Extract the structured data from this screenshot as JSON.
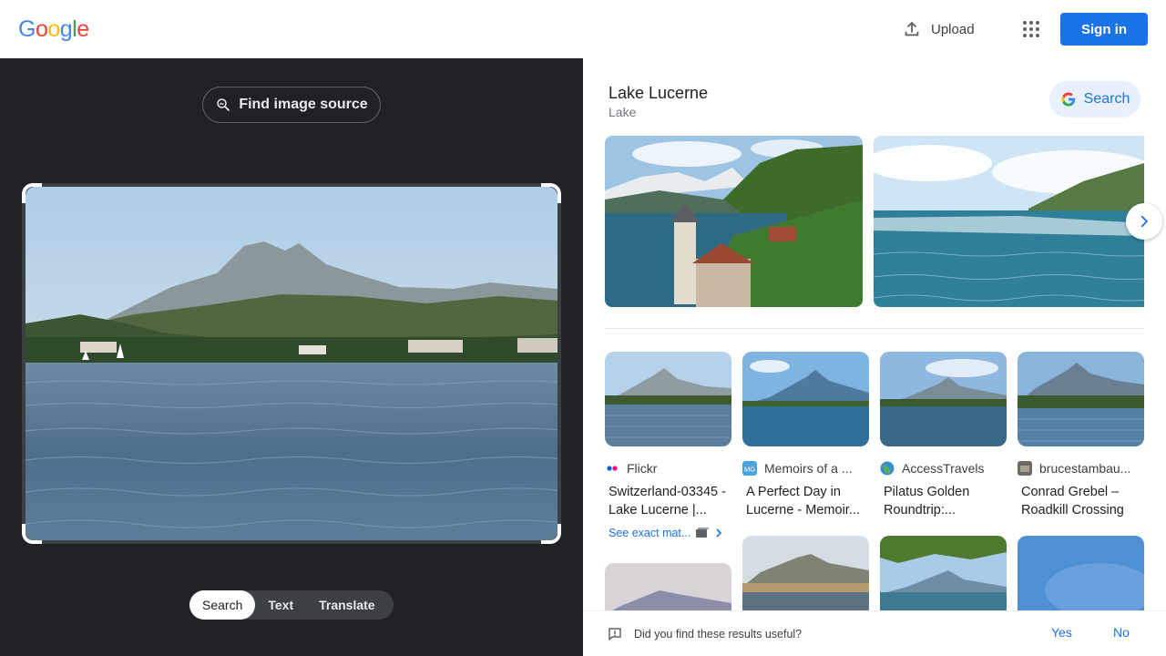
{
  "header": {
    "logo_letters": [
      {
        "char": "G",
        "color": "#4285f4"
      },
      {
        "char": "o",
        "color": "#ea4335"
      },
      {
        "char": "o",
        "color": "#fbbc05"
      },
      {
        "char": "g",
        "color": "#4285f4"
      },
      {
        "char": "l",
        "color": "#34a853"
      },
      {
        "char": "e",
        "color": "#ea4335"
      }
    ],
    "upload_label": "Upload",
    "sign_in_label": "Sign in"
  },
  "left_panel": {
    "find_source_label": "Find image source",
    "modes": [
      "Search",
      "Text",
      "Translate"
    ],
    "active_mode": "Search"
  },
  "knowledge": {
    "title": "Lake Lucerne",
    "subtitle": "Lake",
    "search_label": "Search"
  },
  "results": [
    {
      "source": "Flickr",
      "title": "Switzerland-03345 - Lake Lucerne |...",
      "exact_label": "See exact mat...",
      "icon": "flickr-icon"
    },
    {
      "source": "Memoirs of a ...",
      "title": "A Perfect Day in Lucerne - Memoir...",
      "icon": "mg-icon"
    },
    {
      "source": "AccessTravels",
      "title": "Pilatus Golden Roundtrip:...",
      "icon": "globe-icon"
    },
    {
      "source": "brucestambau...",
      "title": "Conrad Grebel – Roadkill Crossing",
      "icon": "site-icon"
    }
  ],
  "feedback": {
    "question": "Did you find these results useful?",
    "yes_label": "Yes",
    "no_label": "No"
  },
  "colors": {
    "accent": "#1a73e8",
    "dark_panel": "#202124"
  }
}
